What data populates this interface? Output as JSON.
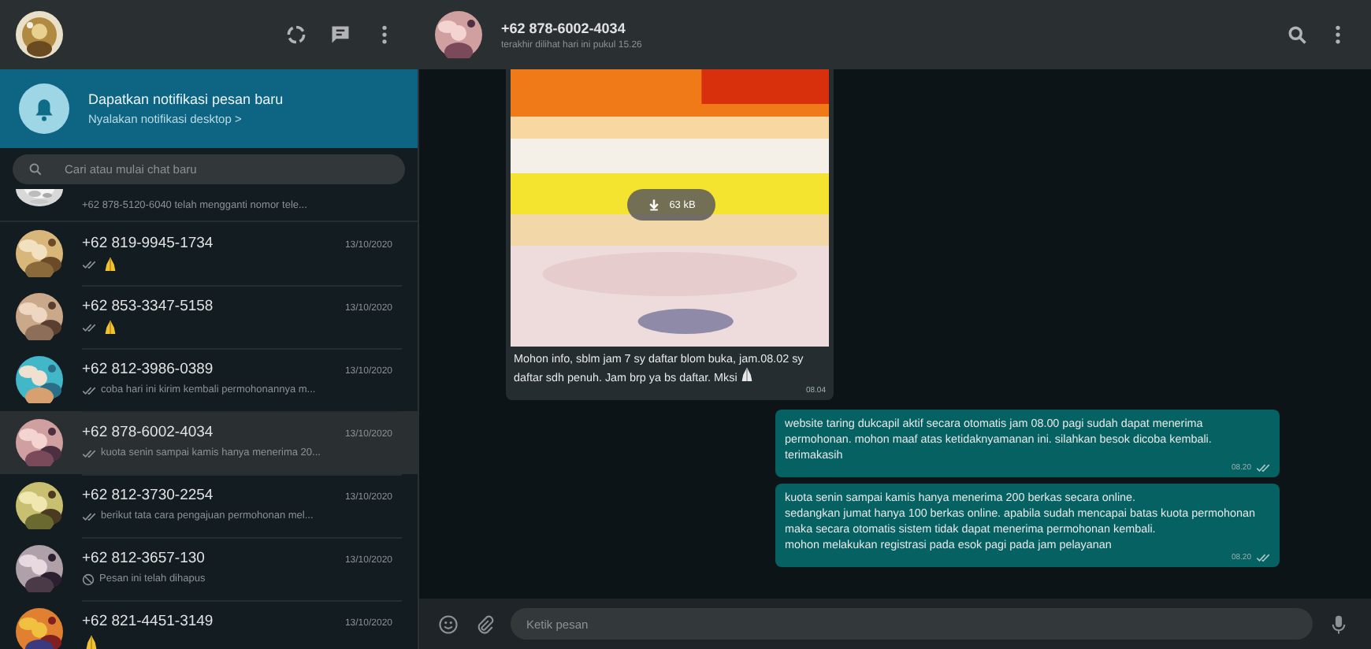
{
  "sidebar": {
    "notification": {
      "title": "Dapatkan notifikasi pesan baru",
      "link": "Nyalakan notifikasi desktop >"
    },
    "search": {
      "placeholder": "Cari atau mulai chat baru"
    },
    "partial_preview": "+62 878-5120-6040 telah mengganti nomor tele...",
    "chats": [
      {
        "name": "+62 819-9945-1734",
        "date": "13/10/2020",
        "kind": "emoji",
        "ticks": true,
        "selected": false
      },
      {
        "name": "+62 853-3347-5158",
        "date": "13/10/2020",
        "kind": "emoji",
        "ticks": true,
        "selected": false
      },
      {
        "name": "+62 812-3986-0389",
        "date": "13/10/2020",
        "kind": "text",
        "preview": "coba hari ini kirim kembali permohonannya m...",
        "ticks": true,
        "selected": false
      },
      {
        "name": "+62 878-6002-4034",
        "date": "13/10/2020",
        "kind": "text",
        "preview": "kuota senin sampai kamis hanya menerima 20...",
        "ticks": true,
        "selected": true
      },
      {
        "name": "+62 812-3730-2254",
        "date": "13/10/2020",
        "kind": "text",
        "preview": "berikut tata cara pengajuan permohonan mel...",
        "ticks": true,
        "selected": false
      },
      {
        "name": "+62 812-3657-130",
        "date": "13/10/2020",
        "kind": "deleted",
        "preview": "Pesan ini telah dihapus",
        "ticks": false,
        "selected": false
      },
      {
        "name": "+62 821-4451-3149",
        "date": "13/10/2020",
        "kind": "emoji",
        "ticks": false,
        "selected": false
      }
    ]
  },
  "chat": {
    "name": "+62 878-6002-4034",
    "status": "terakhir dilihat hari ini pukul 15.26",
    "messages": [
      {
        "outgoing": false,
        "download": "63 kB",
        "caption": "Mohon info, sblm jam 7 sy daftar blom buka, jam.08.02 sy daftar sdh penuh. Jam brp ya bs daftar. Mksi",
        "emoji": true,
        "time": "08.04"
      },
      {
        "kind": "text",
        "outgoing": true,
        "text": "website taring dukcapil aktif secara otomatis jam 08.00 pagi sudah dapat menerima permohonan. mohon maaf atas ketidaknyamanan ini. silahkan besok dicoba kembali. terimakasih",
        "time": "08.20",
        "ticks": true
      },
      {
        "kind": "text",
        "outgoing": true,
        "text": "kuota senin sampai kamis hanya menerima 200 berkas secara online.\nsedangkan jumat hanya 100 berkas online. apabila sudah mencapai batas kuota permohonan\nmaka secara otomatis sistem tidak dapat menerima permohonan kembali.\nmohon melakukan registrasi pada esok pagi pada jam pelayanan",
        "time": "08.20",
        "ticks": true
      }
    ],
    "composer": {
      "placeholder": "Ketik pesan"
    }
  }
}
